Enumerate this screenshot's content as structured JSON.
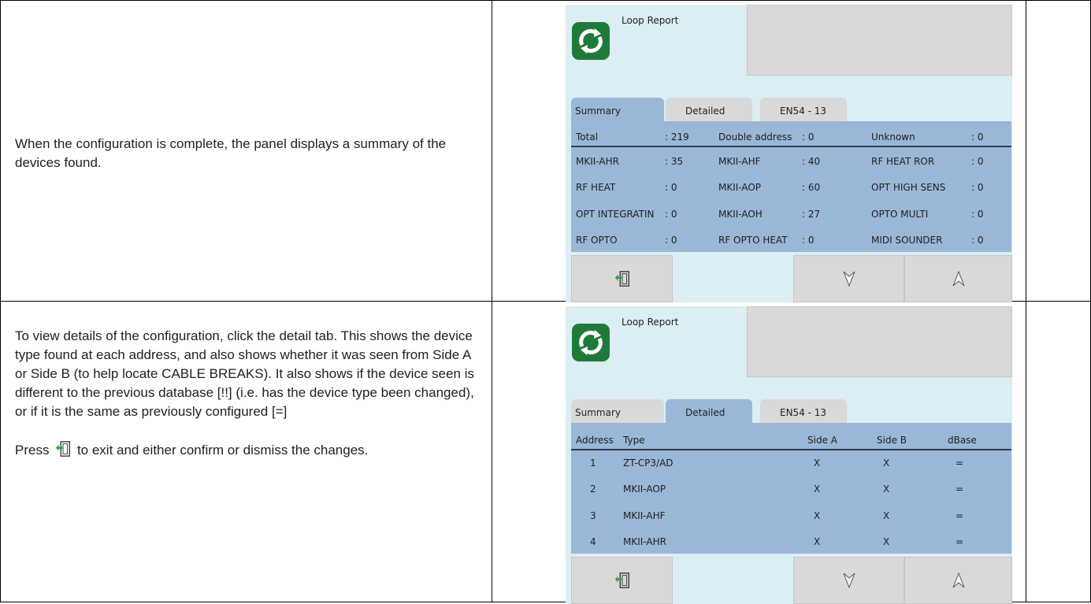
{
  "rows": [
    {
      "text": [
        "When the configuration is complete, the panel displays a summary of the devices found."
      ]
    },
    {
      "text": [
        "To view details of the configuration, click the detail tab. This shows the device type found at each address, and also shows whether it was seen from Side A or Side B (to help locate CABLE BREAKS). It also shows if the device seen is different to the previous database [!!] (i.e. has the device type been changed), or if it is the same as previously configured [=]"
      ],
      "press_prefix": "Press",
      "press_suffix": "to exit and either confirm or dismiss the changes."
    }
  ],
  "panel": {
    "title": "Loop Report",
    "tabs": [
      "Summary",
      "Detailed",
      "EN54 - 13"
    ],
    "summary": {
      "total": {
        "label": "Total",
        "value": ": 219"
      },
      "double": {
        "label": "Double address",
        "value": ": 0"
      },
      "unknown": {
        "label": "Unknown",
        "value": ": 0"
      },
      "rows": [
        [
          [
            "MKII-AHR",
            ": 35"
          ],
          [
            "MKII-AHF",
            ": 40"
          ],
          [
            "RF HEAT ROR",
            ": 0"
          ]
        ],
        [
          [
            "RF HEAT",
            ": 0"
          ],
          [
            "MKII-AOP",
            ": 60"
          ],
          [
            "OPT HIGH SENS",
            ": 0"
          ]
        ],
        [
          [
            "OPT INTEGRATIN",
            ": 0"
          ],
          [
            "MKII-AOH",
            ": 27"
          ],
          [
            "OPTO MULTI",
            ": 0"
          ]
        ],
        [
          [
            "RF OPTO",
            ": 0"
          ],
          [
            "RF OPTO HEAT",
            ": 0"
          ],
          [
            "MIDI SOUNDER",
            ": 0"
          ]
        ]
      ]
    },
    "detailed": {
      "headers": [
        "Address",
        "Type",
        "Side A",
        "Side B",
        "dBase"
      ],
      "rows": [
        [
          "1",
          "ZT-CP3/AD",
          "X",
          "X",
          "="
        ],
        [
          "2",
          "MKII-AOP",
          "X",
          "X",
          "="
        ],
        [
          "3",
          "MKII-AHF",
          "X",
          "X",
          "="
        ],
        [
          "4",
          "MKII-AHR",
          "X",
          "X",
          "="
        ]
      ]
    },
    "buttons": {
      "exit": "exit-icon",
      "down": "chevron-down-icon",
      "up": "chevron-up-icon"
    },
    "colors": {
      "background": "#daeef3",
      "table": "#9bb7d7",
      "logo": "#1f7a3a"
    }
  }
}
